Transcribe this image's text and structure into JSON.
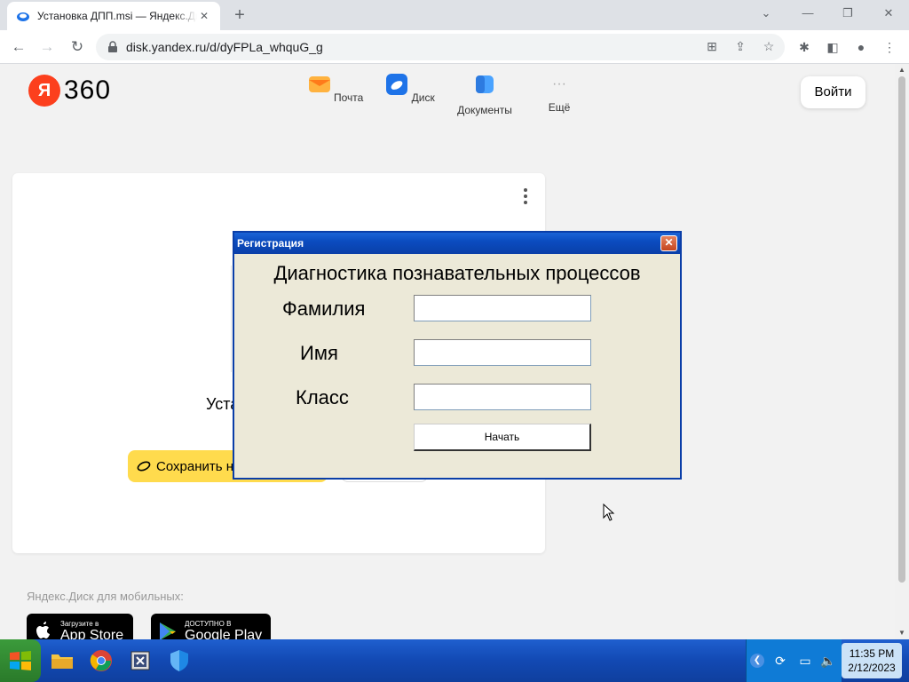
{
  "browser": {
    "tab_title": "Установка ДПП.msi — Яндекс.Диск",
    "tab_close": "✕",
    "new_tab": "+",
    "url": "disk.yandex.ru/d/dyFPLa_whquG_g"
  },
  "site": {
    "logo_letter": "Я",
    "logo_number": "360",
    "services": [
      {
        "label": "Почта",
        "color": "#ffb23f"
      },
      {
        "label": "Диск",
        "color": "#1e73e8"
      },
      {
        "label": "Документы",
        "color": "#4aa3ff"
      },
      {
        "label": "Ещё",
        "color": "#cccccc"
      }
    ],
    "more_dots": "···",
    "login": "Войти",
    "file_name_partial": "Уста",
    "save_button": "Сохранить на Яндекс Диск",
    "mobile_label": "Яндекс.Диск для мобильных:",
    "appstore_small": "Загрузите в",
    "appstore_big": "App Store",
    "googleplay_small": "ДОСТУПНО В",
    "googleplay_big": "Google Play"
  },
  "dialog": {
    "title": "Регистрация",
    "close": "✕",
    "heading": "Диагностика познавательных процессов",
    "field_surname_label": "Фамилия",
    "field_surname_value": "",
    "field_name_label": "Имя",
    "field_name_value": "",
    "field_class_label": "Класс",
    "field_class_value": "",
    "start_button": "Начать"
  },
  "taskbar": {
    "time": "11:35 PM",
    "date": "2/12/2023"
  }
}
